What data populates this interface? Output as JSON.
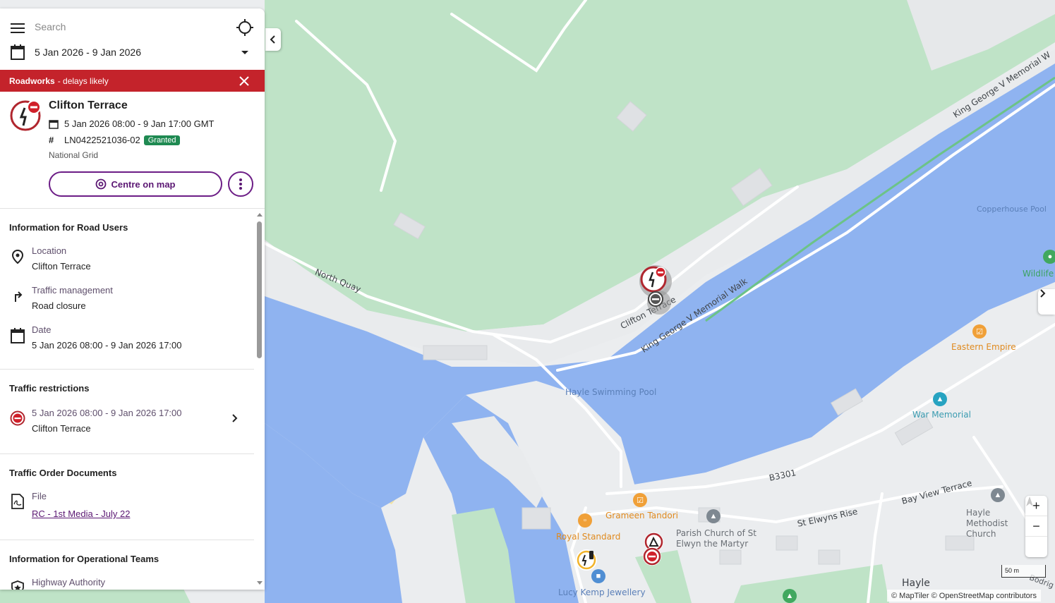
{
  "search": {
    "placeholder": "Search"
  },
  "date_filter": {
    "range": "5 Jan 2026 - 9 Jan 2026"
  },
  "banner": {
    "title": "Roadworks",
    "subtitle": "- delays likely"
  },
  "work": {
    "title": "Clifton Terrace",
    "datetime": "5 Jan 2026 08:00 - 9 Jan 17:00 GMT",
    "reference": "LN0422521036-02",
    "status": "Granted",
    "promoter": "National Grid",
    "centre_button": "Centre on map"
  },
  "sections": {
    "road_users": {
      "title": "Information for Road Users",
      "location_label": "Location",
      "location_value": "Clifton Terrace",
      "traffic_label": "Traffic management",
      "traffic_value": "Road closure",
      "date_label": "Date",
      "date_value": "5 Jan 2026 08:00 - 9 Jan 2026 17:00"
    },
    "restrictions": {
      "title": "Traffic restrictions",
      "item_date": "5 Jan 2026 08:00 - 9 Jan 2026 17:00",
      "item_location": "Clifton Terrace"
    },
    "documents": {
      "title": "Traffic Order Documents",
      "file_label": "File",
      "file_link": "RC - 1st Media - July 22"
    },
    "operational": {
      "title": "Information for Operational Teams",
      "highway_label": "Highway Authority"
    }
  },
  "map": {
    "labels": {
      "north_quay": "North Quay",
      "clifton_terrace": "Clifton Terrace",
      "king_george_walk": "King George V Memorial Walk",
      "king_george_top": "King George V Memorial W",
      "copperhouse_pool": "Copperhouse Pool",
      "wildlife": "Wildlife",
      "eastern_empire": "Eastern Empire",
      "war_memorial": "War Memorial",
      "hayle_pool": "Hayle Swimming Pool",
      "b3301": "B3301",
      "bay_view": "Bay View Terrace",
      "st_elwyns": "St Elwyns Rise",
      "grameen": "Grameen Tandori",
      "royal_standard": "Royal Standard",
      "parish_church": "Parish Church of St Elwyn the Martyr",
      "methodist": "Hayle Methodist Church",
      "lucy_kemp": "Lucy Kemp Jewellery",
      "hayle": "Hayle",
      "bodriggy": "Bodrig"
    },
    "scale": "50 m",
    "attribution": "© MapTiler © OpenStreetMap contributors",
    "zoom_in": "+",
    "zoom_out": "−"
  },
  "icons": [
    "menu-icon",
    "locate-icon",
    "calendar-icon",
    "dropdown-icon",
    "close-icon",
    "roadworks-icon",
    "hash-icon",
    "target-icon",
    "more-icon",
    "pin-icon",
    "turn-icon",
    "no-entry-icon",
    "chevron-right-icon",
    "pdf-icon",
    "shield-icon",
    "chevron-left-icon",
    "compass-icon"
  ],
  "colors": {
    "accent": "#6c1d86",
    "banner": "#c4232b",
    "granted": "#1f8a52",
    "water": "#8fb3f0",
    "park": "#bde3c8"
  }
}
